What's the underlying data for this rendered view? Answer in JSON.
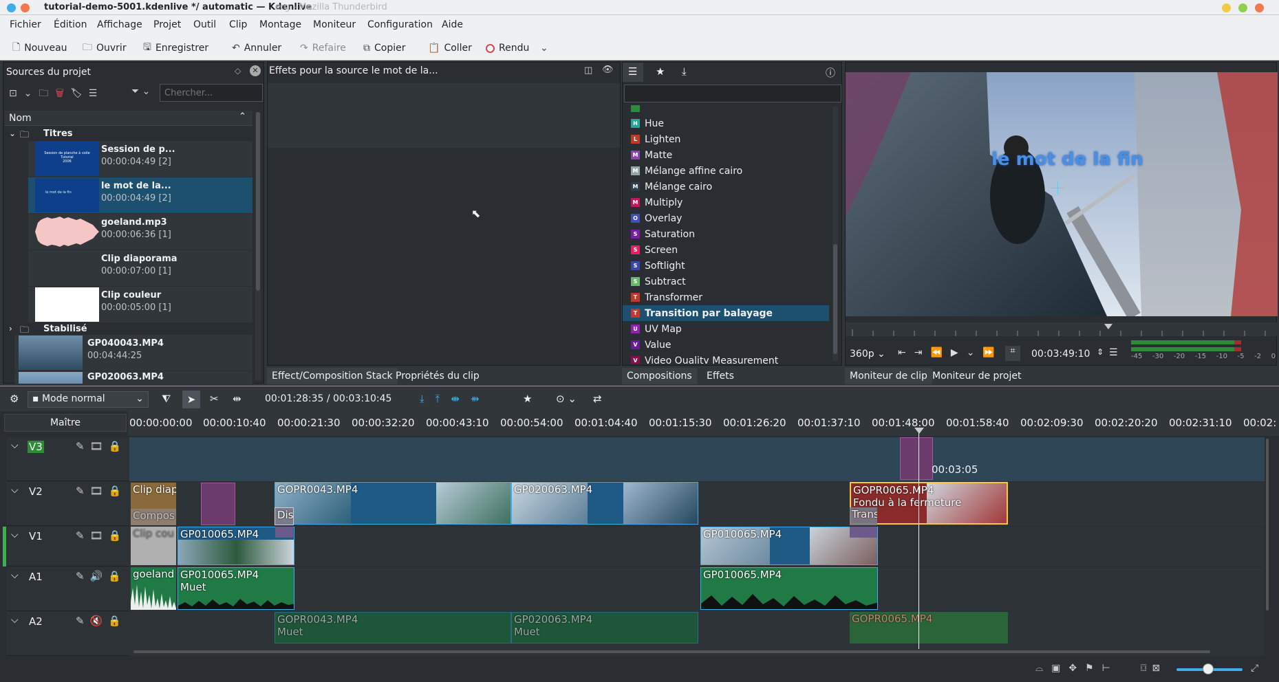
{
  "window": {
    "title": "tutorial-demo-5001.kdenlive */ automatic — Kdenlive",
    "ghost_title": "erg - Mozilla Thunderbird"
  },
  "menu": [
    "Fichier",
    "Édition",
    "Affichage",
    "Projet",
    "Outil",
    "Clip",
    "Montage",
    "Moniteur",
    "Configuration",
    "Aide"
  ],
  "toolbar": {
    "new": "Nouveau",
    "open": "Ouvrir",
    "save": "Enregistrer",
    "undo": "Annuler",
    "redo": "Refaire",
    "copy": "Copier",
    "paste": "Coller",
    "render": "Rendu"
  },
  "bin": {
    "title": "Sources du projet",
    "search_placeholder": "Chercher...",
    "column": "Nom",
    "folder1": "Titres",
    "items": [
      {
        "name": "Session de p...",
        "duration": "00:00:04:49 [2]",
        "thumb_line1": "Session de planche à voile",
        "thumb_line2": "Tutorial",
        "thumb_line3": "2006"
      },
      {
        "name": "le mot de la...",
        "duration": "00:00:04:49 [2]",
        "thumb_line1": "le mot de la fin"
      },
      {
        "name": "goeland.mp3",
        "duration": "00:00:06:36 [1]"
      },
      {
        "name": "Clip diaporama",
        "duration": "00:00:07:00 [1]"
      },
      {
        "name": "Clip couleur",
        "duration": "00:00:05:00 [1]"
      }
    ],
    "folder2": "Stabilisé",
    "items2": [
      {
        "name": "GP040043.MP4",
        "duration": "00:04:44:25"
      },
      {
        "name": "GP020063.MP4",
        "duration": ""
      }
    ]
  },
  "effect_stack": {
    "title": "Effets pour la source le mot de la..."
  },
  "effects_list": [
    {
      "letter": "H",
      "name": "Hue",
      "color": "#26a69a"
    },
    {
      "letter": "L",
      "name": "Lighten",
      "color": "#c0392b"
    },
    {
      "letter": "M",
      "name": "Matte",
      "color": "#8e44ad"
    },
    {
      "letter": "M",
      "name": "Mélange affine cairo",
      "color": "#95a5a6"
    },
    {
      "letter": "M",
      "name": "Mélange cairo",
      "color": "#2c3e50"
    },
    {
      "letter": "M",
      "name": "Multiply",
      "color": "#c2185b"
    },
    {
      "letter": "O",
      "name": "Overlay",
      "color": "#3f51b5"
    },
    {
      "letter": "S",
      "name": "Saturation",
      "color": "#7b1fa2"
    },
    {
      "letter": "S",
      "name": "Screen",
      "color": "#e91e63"
    },
    {
      "letter": "S",
      "name": "Softlight",
      "color": "#3949ab"
    },
    {
      "letter": "S",
      "name": "Subtract",
      "color": "#66bb6a"
    },
    {
      "letter": "T",
      "name": "Transformer",
      "color": "#c0392b"
    },
    {
      "letter": "T",
      "name": "Transition par balayage",
      "color": "#c0392b"
    },
    {
      "letter": "U",
      "name": "UV Map",
      "color": "#8e24aa"
    },
    {
      "letter": "V",
      "name": "Value",
      "color": "#6a1b9a"
    },
    {
      "letter": "V",
      "name": "Video Quality Measurement",
      "color": "#880e4f"
    }
  ],
  "tabs_left": {
    "stack": "Effect/Composition Stack",
    "clip_props": "Propriétés du clip"
  },
  "tabs_mid": {
    "compositions": "Compositions",
    "effects": "Effets"
  },
  "tabs_right": {
    "clip_monitor": "Moniteur de clip",
    "project_monitor": "Moniteur de projet"
  },
  "monitor": {
    "overlay_text": "le mot de la fin",
    "resolution": "360p",
    "timecode": "00:03:49:10",
    "meter": [
      "-45",
      "-30",
      "-20",
      "-15",
      "-10",
      "-5",
      "-2",
      "0"
    ]
  },
  "timeline": {
    "mode": "Mode normal",
    "position": "00:01:28:35 / 00:03:10:45",
    "master": "Maître",
    "ruler": [
      "00:00:00:00",
      "00:00:10:40",
      "00:00:21:30",
      "00:00:32:20",
      "00:00:43:10",
      "00:00:54:00",
      "00:01:04:40",
      "00:01:15:30",
      "00:01:26:20",
      "00:01:37:10",
      "00:01:48:00",
      "00:01:58:40",
      "00:02:09:30",
      "00:02:20:20",
      "00:02:31:10",
      "00:02:"
    ],
    "tracks": [
      "V3",
      "V2",
      "V1",
      "A1",
      "A2"
    ],
    "clips": {
      "v3_dur": "00:03:05",
      "clip_dia": "Clip diap",
      "compos": "Compos",
      "clip_cou": "Clip cou",
      "gopr0043": "GOPR0043.MP4",
      "gp020063": "GP020063.MP4",
      "dis": "Dis",
      "gopr0065": "GOPR0065.MP4",
      "fondu": "Fondu à la fermeture",
      "trans": "Trans",
      "gp010065": "GP010065.MP4",
      "goeland": "goeland",
      "muet": "Muet"
    }
  }
}
